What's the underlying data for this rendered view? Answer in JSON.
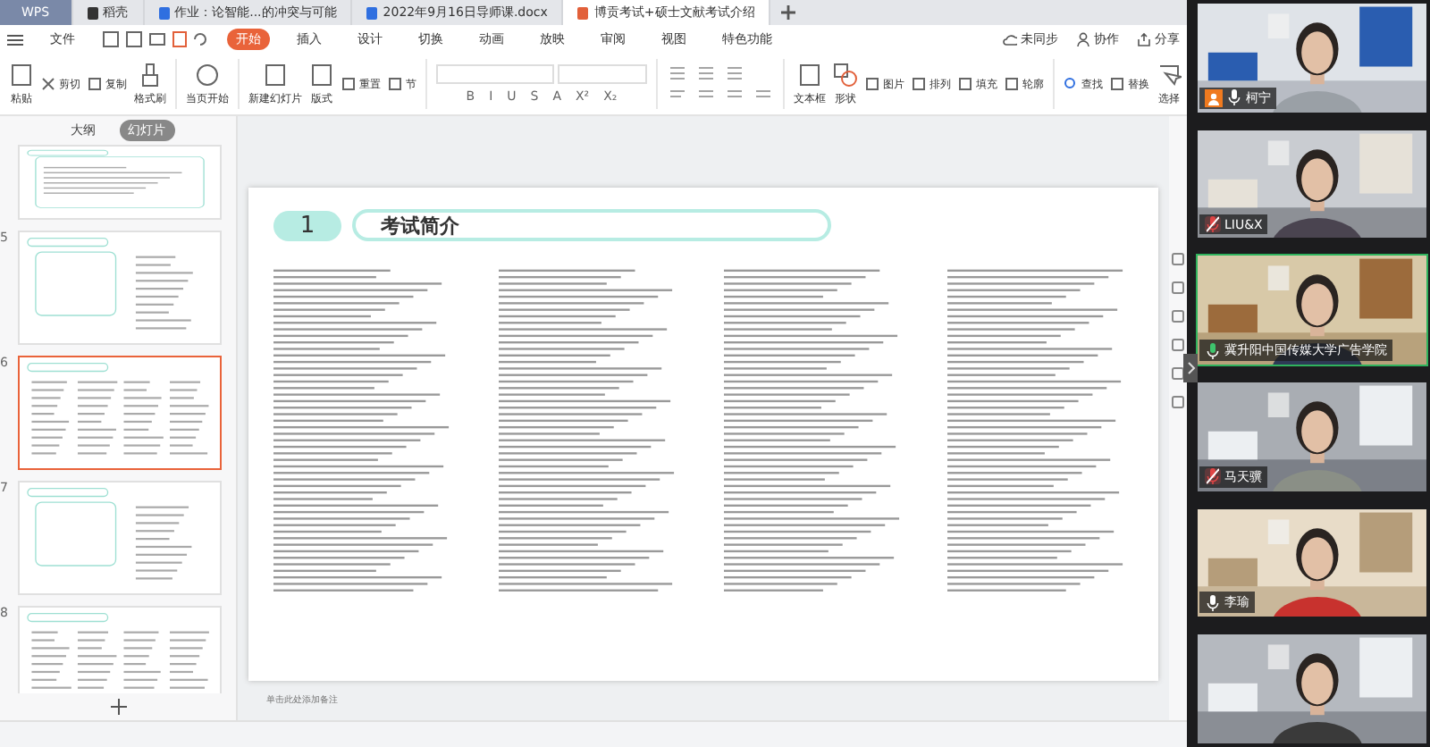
{
  "app_button": "WPS",
  "tabs": [
    {
      "label": "稻壳",
      "kind": "doc",
      "selected": false
    },
    {
      "label": "作业：论智能...的冲突与可能",
      "kind": "word",
      "selected": false
    },
    {
      "label": "2022年9月16日导师课.docx",
      "kind": "word",
      "selected": false
    },
    {
      "label": "博贡考试+硕士文献考试介绍",
      "kind": "ppt",
      "selected": true
    }
  ],
  "menu": {
    "file": "文件",
    "items": [
      {
        "label": "开始",
        "selected": true
      },
      {
        "label": "插入",
        "selected": false
      },
      {
        "label": "设计",
        "selected": false
      },
      {
        "label": "切换",
        "selected": false
      },
      {
        "label": "动画",
        "selected": false
      },
      {
        "label": "放映",
        "selected": false
      },
      {
        "label": "审阅",
        "selected": false
      },
      {
        "label": "视图",
        "selected": false
      },
      {
        "label": "特色功能",
        "selected": false
      }
    ],
    "actions": [
      {
        "label": "未同步",
        "kind": "cloud"
      },
      {
        "label": "协作",
        "kind": "person"
      },
      {
        "label": "分享",
        "kind": "share"
      }
    ]
  },
  "ribbon": {
    "groups": [
      [
        {
          "label": "粘贴",
          "kind": "clipboard",
          "large": true
        },
        {
          "label": "剪切",
          "kind": "scissors",
          "large": false
        },
        {
          "label": "复制",
          "kind": "copy",
          "large": false
        },
        {
          "label": "格式刷",
          "kind": "brush",
          "large": true
        }
      ],
      [
        {
          "label": "当页开始",
          "kind": "play",
          "large": true
        }
      ],
      [
        {
          "label": "新建幻灯片",
          "kind": "slide",
          "large": true
        },
        {
          "label": "版式",
          "kind": "layout",
          "large": true
        },
        {
          "label": "重置",
          "kind": "layout",
          "large": false
        },
        {
          "label": "节",
          "kind": "copy",
          "large": false
        }
      ]
    ],
    "format_buttons": [
      "B",
      "I",
      "U",
      "S",
      "A",
      "X²",
      "X₂"
    ],
    "groups_right": [
      [
        {
          "label": "文本框",
          "kind": "slide",
          "large": true
        },
        {
          "label": "形状",
          "kind": "shapes",
          "large": true
        },
        {
          "label": "图片",
          "kind": "layout",
          "large": false
        },
        {
          "label": "排列",
          "kind": "copy",
          "large": false
        },
        {
          "label": "填充",
          "kind": "brush",
          "large": false
        },
        {
          "label": "轮廓",
          "kind": "copy",
          "large": false
        }
      ],
      [
        {
          "label": "查找",
          "kind": "search",
          "large": false
        },
        {
          "label": "替换",
          "kind": "copy",
          "large": false
        },
        {
          "label": "选择",
          "kind": "select",
          "large": true
        }
      ]
    ]
  },
  "panel": {
    "views": [
      {
        "label": "大纲",
        "selected": false
      },
      {
        "label": "幻灯片",
        "selected": true
      }
    ],
    "thumbnails": [
      {
        "kind": "text",
        "selected": false
      },
      {
        "number": "5",
        "kind": "split",
        "selected": false
      },
      {
        "number": "6",
        "kind": "columns",
        "selected": true
      },
      {
        "number": "7",
        "kind": "split",
        "selected": false
      },
      {
        "number": "8",
        "kind": "columns",
        "selected": false
      }
    ]
  },
  "slide": {
    "number": "1",
    "title": "考试简介"
  },
  "notes": {
    "placeholder": "单击此处添加备注"
  },
  "participants": [
    {
      "name": "柯宁",
      "host": true,
      "muted": false,
      "speaking": false
    },
    {
      "name": "LIU&X",
      "host": false,
      "muted": true,
      "speaking": false
    },
    {
      "name": "冀升阳中国传媒大学广告学院",
      "host": false,
      "muted": false,
      "speaking": true
    },
    {
      "name": "马天骥",
      "host": false,
      "muted": true,
      "speaking": false
    },
    {
      "name": "李瑜",
      "host": false,
      "muted": false,
      "speaking": false
    },
    {
      "speaking": false
    }
  ]
}
